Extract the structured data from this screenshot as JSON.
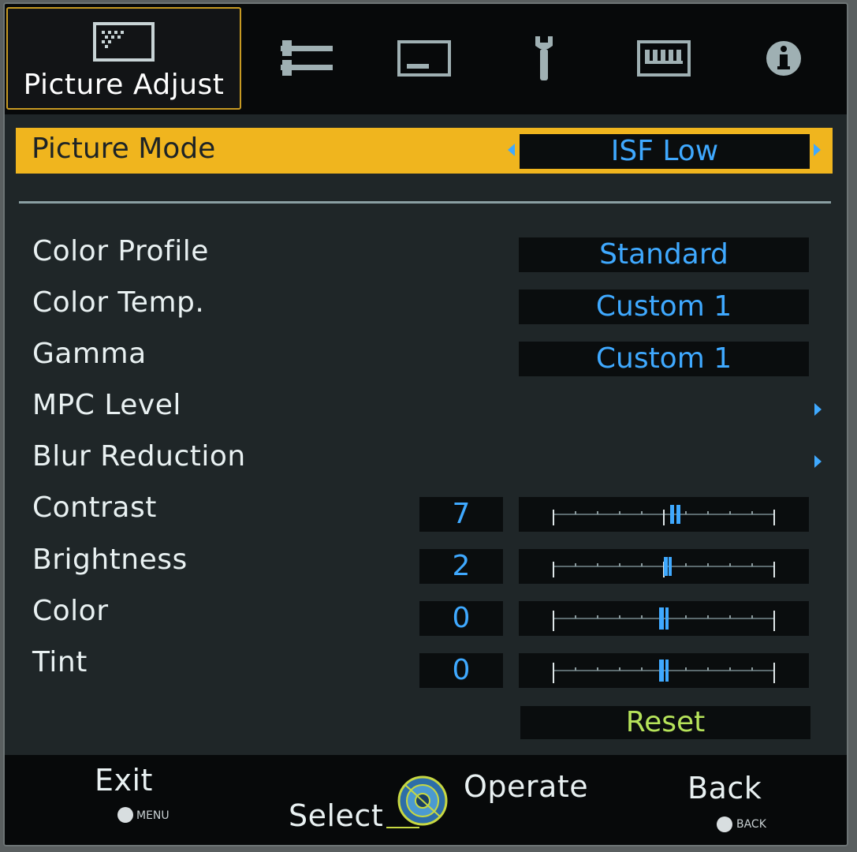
{
  "tabs": [
    {
      "label": "Picture Adjust",
      "icon": "picture-icon",
      "active": true
    },
    {
      "label": "",
      "icon": "settings-sliders-icon",
      "active": false
    },
    {
      "label": "",
      "icon": "display-icon",
      "active": false
    },
    {
      "label": "",
      "icon": "wrench-icon",
      "active": false
    },
    {
      "label": "",
      "icon": "keyboard-icon",
      "active": false
    },
    {
      "label": "",
      "icon": "info-icon",
      "active": false
    }
  ],
  "picture_mode": {
    "label": "Picture Mode",
    "value": "ISF Low"
  },
  "settings": {
    "color_profile": {
      "label": "Color Profile",
      "value": "Standard"
    },
    "color_temp": {
      "label": "Color Temp.",
      "value": "Custom 1"
    },
    "gamma": {
      "label": "Gamma",
      "value": "Custom 1"
    },
    "mpc_level": {
      "label": "MPC Level"
    },
    "blur_reduction": {
      "label": "Blur Reduction"
    }
  },
  "sliders": {
    "contrast": {
      "label": "Contrast",
      "value": "7"
    },
    "brightness": {
      "label": "Brightness",
      "value": "2"
    },
    "color": {
      "label": "Color",
      "value": "0"
    },
    "tint": {
      "label": "Tint",
      "value": "0"
    }
  },
  "reset_label": "Reset",
  "footer": {
    "exit_label": "Exit",
    "exit_key": "MENU",
    "select_label": "Select",
    "operate_label": "Operate",
    "back_label": "Back",
    "back_key": "BACK"
  },
  "colors": {
    "highlight": "#f0b51e",
    "value_text": "#3fa9ff",
    "reset_text": "#b6e35a",
    "tab_border": "#c79a23"
  }
}
